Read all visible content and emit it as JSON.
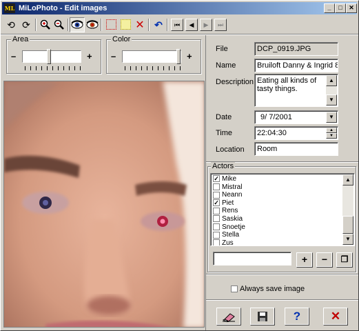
{
  "window": {
    "app_icon": "ML",
    "title": "MiLoPhoto - Edit images"
  },
  "title_buttons": {
    "minimize": "_",
    "maximize": "□",
    "close": "✕"
  },
  "toolbar": {
    "buttons": [
      {
        "name": "rotate-left-icon",
        "glyph": "⟲"
      },
      {
        "name": "rotate-right-icon",
        "glyph": "⟳"
      },
      {
        "name": "zoom-in-icon",
        "glyph": "+"
      },
      {
        "name": "zoom-out-icon",
        "glyph": "−"
      },
      {
        "name": "red-eye-left-icon",
        "glyph": "◉"
      },
      {
        "name": "red-eye-right-icon",
        "glyph": "◉"
      },
      {
        "name": "select-red-icon",
        "glyph": ""
      },
      {
        "name": "select-yellow-icon",
        "glyph": ""
      },
      {
        "name": "clear-selection-icon",
        "glyph": "✕"
      },
      {
        "name": "undo-icon",
        "glyph": "↶"
      },
      {
        "name": "first-icon",
        "glyph": "⏮"
      },
      {
        "name": "previous-icon",
        "glyph": "◀"
      },
      {
        "name": "next-icon",
        "glyph": "▶"
      },
      {
        "name": "last-icon",
        "glyph": "⏭"
      }
    ]
  },
  "area": {
    "label": "Area",
    "minus": "–",
    "plus": "+",
    "level": 0.45
  },
  "color": {
    "label": "Color",
    "minus": "–",
    "plus": "+",
    "level": 1.0
  },
  "form": {
    "file_label": "File",
    "file_value": "DCP_0919.JPG",
    "name_label": "Name",
    "name_value": "Bruiloft Danny & Ingrid 8",
    "description_label": "Description",
    "description_value": "Eating all kinds of tasty things.",
    "date_label": "Date",
    "date_value": "9/ 7/2001",
    "time_label": "Time",
    "time_value": "22:04:30",
    "location_label": "Location",
    "location_value": "Room"
  },
  "actors": {
    "label": "Actors",
    "items": [
      {
        "name": "Mike",
        "checked": true
      },
      {
        "name": "Mistral",
        "checked": false
      },
      {
        "name": "Neann",
        "checked": false
      },
      {
        "name": "Piet",
        "checked": true
      },
      {
        "name": "Rens",
        "checked": false
      },
      {
        "name": "Saskia",
        "checked": false
      },
      {
        "name": "Snoetje",
        "checked": false
      },
      {
        "name": "Stella",
        "checked": false
      },
      {
        "name": "Zus",
        "checked": false
      }
    ],
    "new_actor_value": "",
    "add_glyph": "+",
    "remove_glyph": "−",
    "copy_glyph": "❐"
  },
  "always_save_label": "Always save image",
  "always_save_checked": false,
  "bottom_buttons": {
    "erase": "eraser-icon",
    "save": "save-icon",
    "help": "?",
    "cancel": "✕"
  },
  "colors": {
    "title_start": "#0a246a",
    "title_end": "#a6caf0",
    "help_blue": "#0030b0",
    "cancel_red": "#c00000",
    "face": "#d4d0c8"
  }
}
